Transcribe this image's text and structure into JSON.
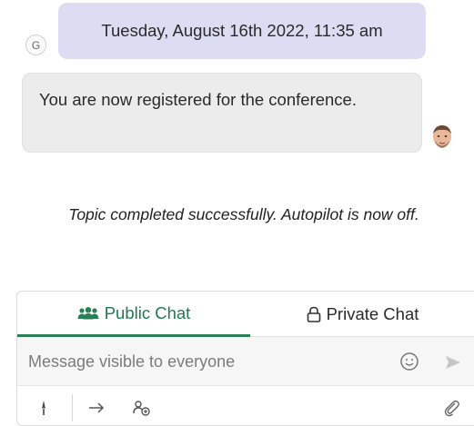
{
  "conversation": {
    "date_stamp": "Tuesday, August 16th 2022, 11:35 am",
    "agent_initial": "G",
    "message_text": "You are now registered for the conference.",
    "system_note": "Topic completed successfully. Autopilot is now off."
  },
  "composer": {
    "tabs": [
      {
        "label": "Public Chat",
        "icon": "people-icon",
        "active": true
      },
      {
        "label": "Private Chat",
        "icon": "lock-icon",
        "active": false
      }
    ],
    "input_placeholder": "Message visible to everyone",
    "accent_color": "#2b7f58"
  }
}
